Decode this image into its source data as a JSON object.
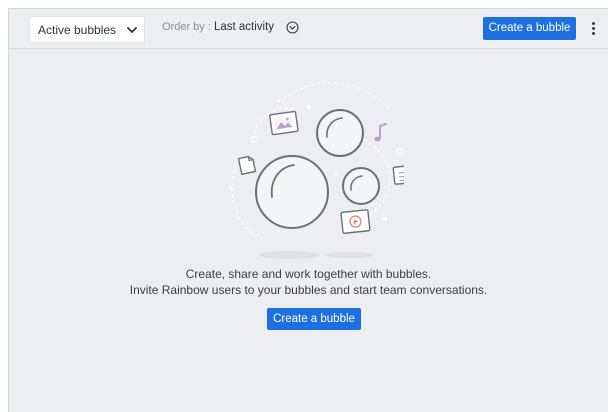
{
  "toolbar": {
    "filter_label": "Active bubbles",
    "order_prefix": "Order by :",
    "order_value": "Last activity",
    "create_label": "Create a bubble"
  },
  "empty_state": {
    "line1": "Create, share and work together with bubbles.",
    "line2": "Invite Rainbow users to your bubbles and start team conversations.",
    "create_label": "Create a bubble"
  },
  "colors": {
    "accent": "#1e6fe0",
    "background": "#eceef1"
  },
  "icons": {
    "filter": "chevron-down-icon",
    "order": "circle-chevron-down-icon",
    "menu": "kebab-menu-icon"
  }
}
